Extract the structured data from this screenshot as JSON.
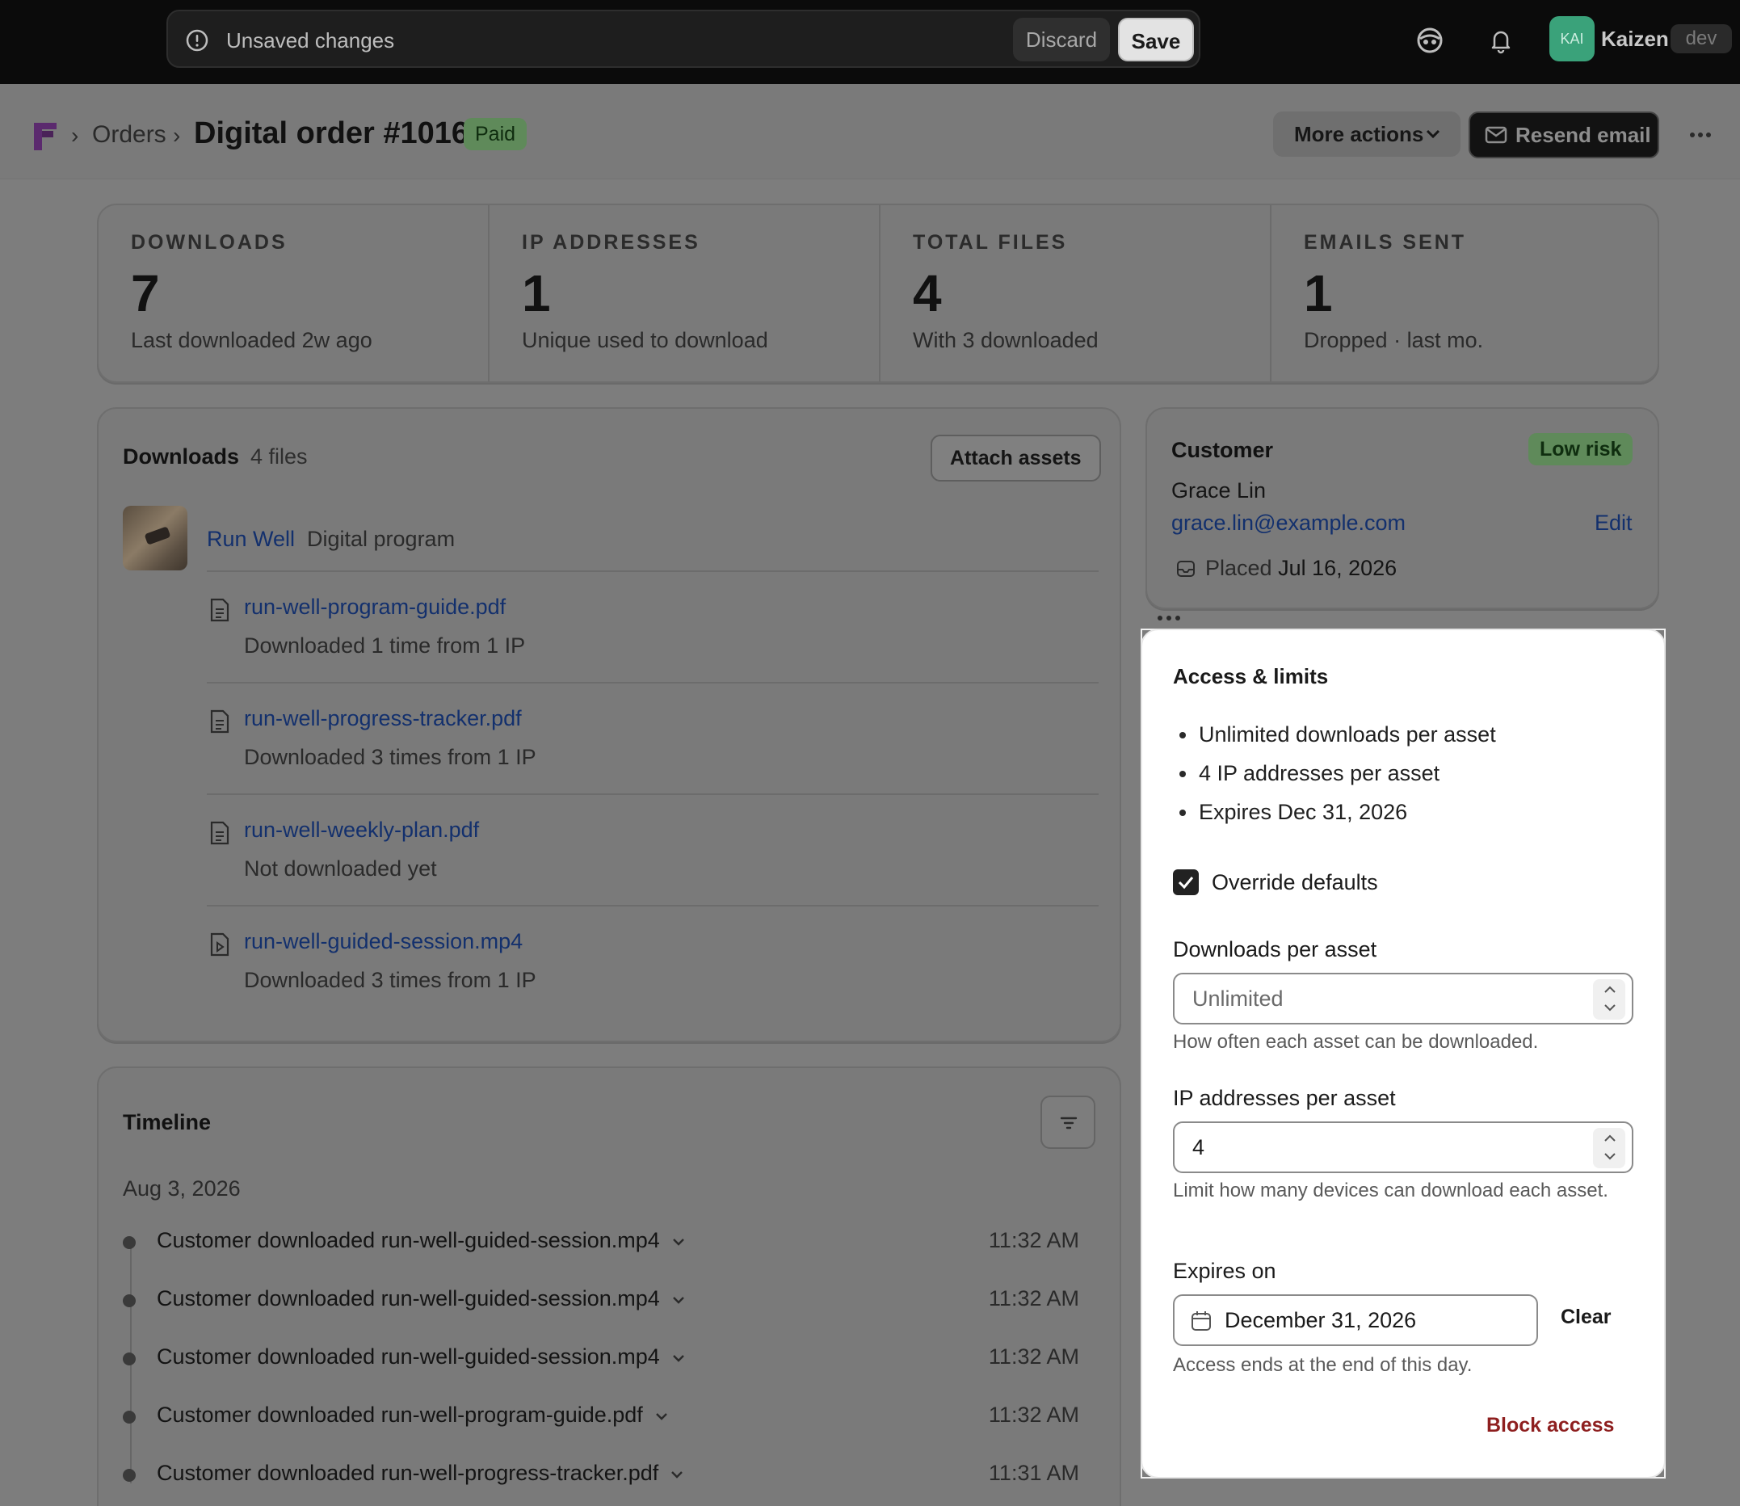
{
  "topbar": {
    "unsaved_text": "Unsaved changes",
    "discard_label": "Discard",
    "save_label": "Save",
    "avatar_initials": "KAI",
    "store_name": "Kaizen",
    "env_badge": "dev"
  },
  "header": {
    "breadcrumb_orders": "Orders",
    "title": "Digital order #1016",
    "status_badge": "Paid",
    "more_actions_label": "More actions",
    "resend_label": "Resend email"
  },
  "stats": [
    {
      "label": "DOWNLOADS",
      "value": "7",
      "sub": "Last downloaded 2w ago"
    },
    {
      "label": "IP ADDRESSES",
      "value": "1",
      "sub": "Unique used to download"
    },
    {
      "label": "TOTAL FILES",
      "value": "4",
      "sub": "With 3 downloaded"
    },
    {
      "label": "EMAILS SENT",
      "value": "1",
      "sub": "Dropped · last mo."
    }
  ],
  "downloads": {
    "title": "Downloads",
    "count": "4 files",
    "attach_label": "Attach assets",
    "product_name": "Run Well",
    "product_type": "Digital program",
    "files": [
      {
        "name": "run-well-program-guide.pdf",
        "meta": "Downloaded 1 time from 1 IP",
        "icon": "document-icon"
      },
      {
        "name": "run-well-progress-tracker.pdf",
        "meta": "Downloaded 3 times from 1 IP",
        "icon": "document-icon"
      },
      {
        "name": "run-well-weekly-plan.pdf",
        "meta": "Not downloaded yet",
        "icon": "document-icon"
      },
      {
        "name": "run-well-guided-session.mp4",
        "meta": "Downloaded 3 times from 1 IP",
        "icon": "video-file-icon"
      }
    ]
  },
  "timeline": {
    "title": "Timeline",
    "date": "Aug 3, 2026",
    "events": [
      {
        "text": "Customer downloaded run-well-guided-session.mp4",
        "time": "11:32 AM"
      },
      {
        "text": "Customer downloaded run-well-guided-session.mp4",
        "time": "11:32 AM"
      },
      {
        "text": "Customer downloaded run-well-guided-session.mp4",
        "time": "11:32 AM"
      },
      {
        "text": "Customer downloaded run-well-program-guide.pdf",
        "time": "11:32 AM"
      },
      {
        "text": "Customer downloaded run-well-progress-tracker.pdf",
        "time": "11:31 AM"
      }
    ]
  },
  "customer": {
    "title": "Customer",
    "risk_badge": "Low risk",
    "name": "Grace Lin",
    "email": "grace.lin@example.com",
    "edit_label": "Edit",
    "placed_label": "Placed",
    "placed_date": "Jul 16, 2026"
  },
  "access": {
    "title": "Access & limits",
    "bullets": [
      "Unlimited downloads per asset",
      "4 IP addresses per asset",
      "Expires Dec 31, 2026"
    ],
    "override_label": "Override defaults",
    "override_checked": true,
    "downloads_label": "Downloads per asset",
    "downloads_placeholder": "Unlimited",
    "downloads_help": "How often each asset can be downloaded.",
    "ip_label": "IP addresses per asset",
    "ip_value": "4",
    "ip_help": "Limit how many devices can download each asset.",
    "expires_label": "Expires on",
    "expires_value": "December 31, 2026",
    "clear_label": "Clear",
    "expires_help": "Access ends at the end of this day.",
    "block_label": "Block access"
  }
}
